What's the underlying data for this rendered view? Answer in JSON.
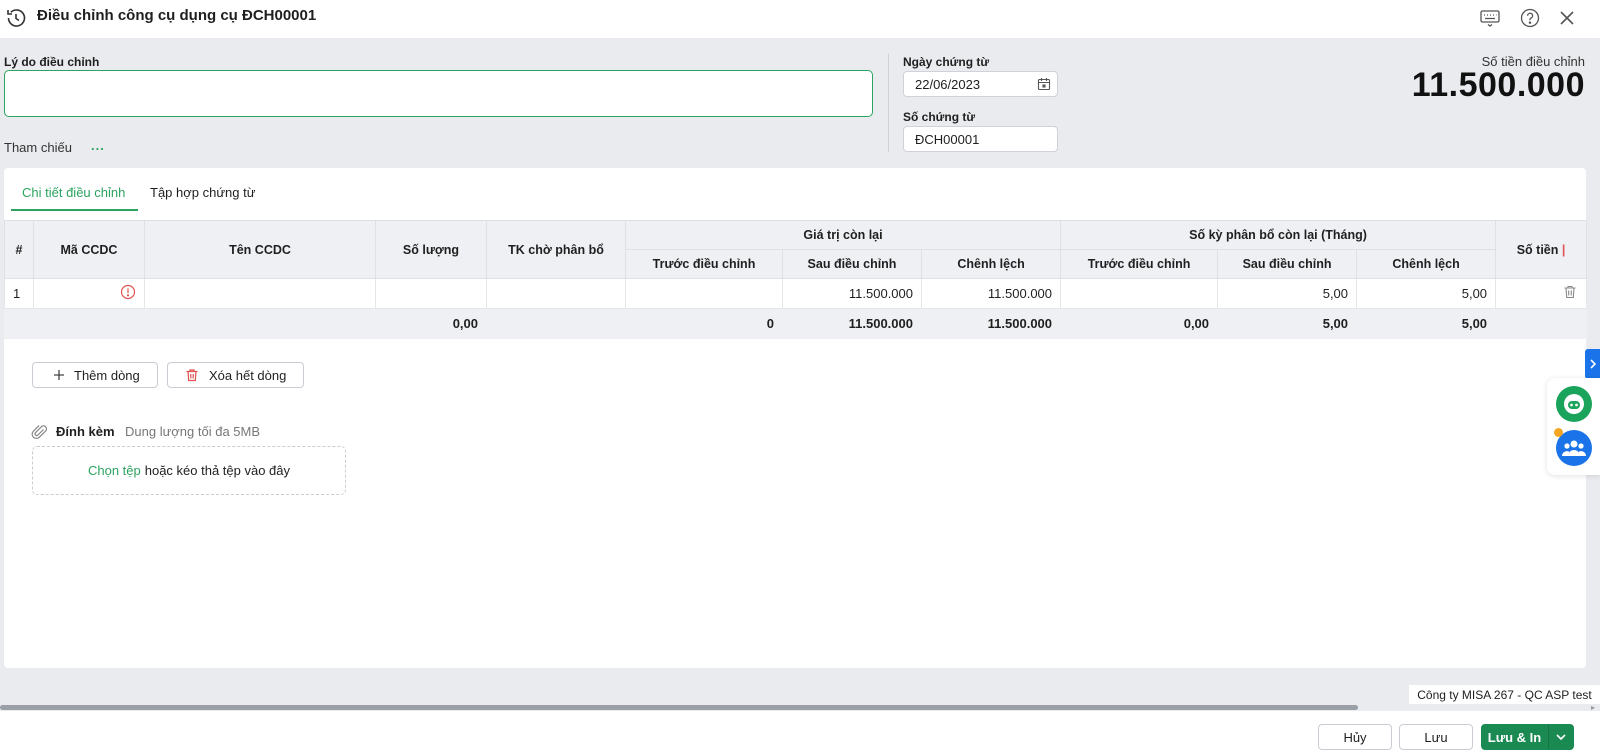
{
  "window": {
    "title": "Điều chỉnh công cụ dụng cụ ĐCH00001",
    "icons": [
      "history-icon",
      "keyboard-icon",
      "help-icon",
      "close-icon"
    ]
  },
  "form": {
    "reason_label": "Lý do điều chỉnh",
    "reason_value": "",
    "reference_label": "Tham chiếu",
    "reference_more": "...",
    "date_label": "Ngày chứng từ",
    "date_value": "22/06/2023",
    "voucher_no_label": "Số chứng từ",
    "voucher_no_value": "ĐCH00001",
    "amount_label": "Số tiền điều chỉnh",
    "amount_value": "11.500.000"
  },
  "tabs": [
    {
      "label": "Chi tiết điều chỉnh",
      "active": true
    },
    {
      "label": "Tập hợp chứng từ",
      "active": false
    }
  ],
  "grid": {
    "headers": {
      "index": "#",
      "code": "Mã CCDC",
      "name": "Tên CCDC",
      "quantity": "Số lượng",
      "pending_account": "TK chờ phân bổ",
      "remaining_value_group": "Giá trị còn lại",
      "remaining_periods_group": "Số kỳ phân bổ còn lại (Tháng)",
      "before": "Trước điều chỉnh",
      "after": "Sau điều chỉnh",
      "diff": "Chênh lệch",
      "amount": "Số tiền"
    },
    "rows": [
      {
        "index": "1",
        "code": "",
        "name": "",
        "quantity": "",
        "pending_account": "",
        "value_before": "",
        "value_after": "11.500.000",
        "value_diff": "11.500.000",
        "period_before": "",
        "period_after": "5,00",
        "period_diff": "5,00",
        "amount": ""
      }
    ],
    "totals": {
      "quantity": "0,00",
      "value_before": "0",
      "value_after": "11.500.000",
      "value_diff": "11.500.000",
      "period_before": "0,00",
      "period_after": "5,00",
      "period_diff": "5,00"
    }
  },
  "actions": {
    "add_row": "Thêm dòng",
    "delete_all_rows": "Xóa hết dòng"
  },
  "attachment": {
    "label": "Đính kèm",
    "limit": "Dung lượng tối đa 5MB",
    "choose_file": "Chọn tệp",
    "drop_text": "hoặc kéo thả tệp vào đây"
  },
  "status": {
    "company": "Công ty MISA 267 - QC ASP test"
  },
  "footer": {
    "cancel": "Hủy",
    "save": "Lưu",
    "save_print": "Lưu & In"
  },
  "colors": {
    "accent": "#2ca360",
    "primary_button": "#1a8a52",
    "warning": "#e05252",
    "side_blue": "#1a73e8"
  }
}
